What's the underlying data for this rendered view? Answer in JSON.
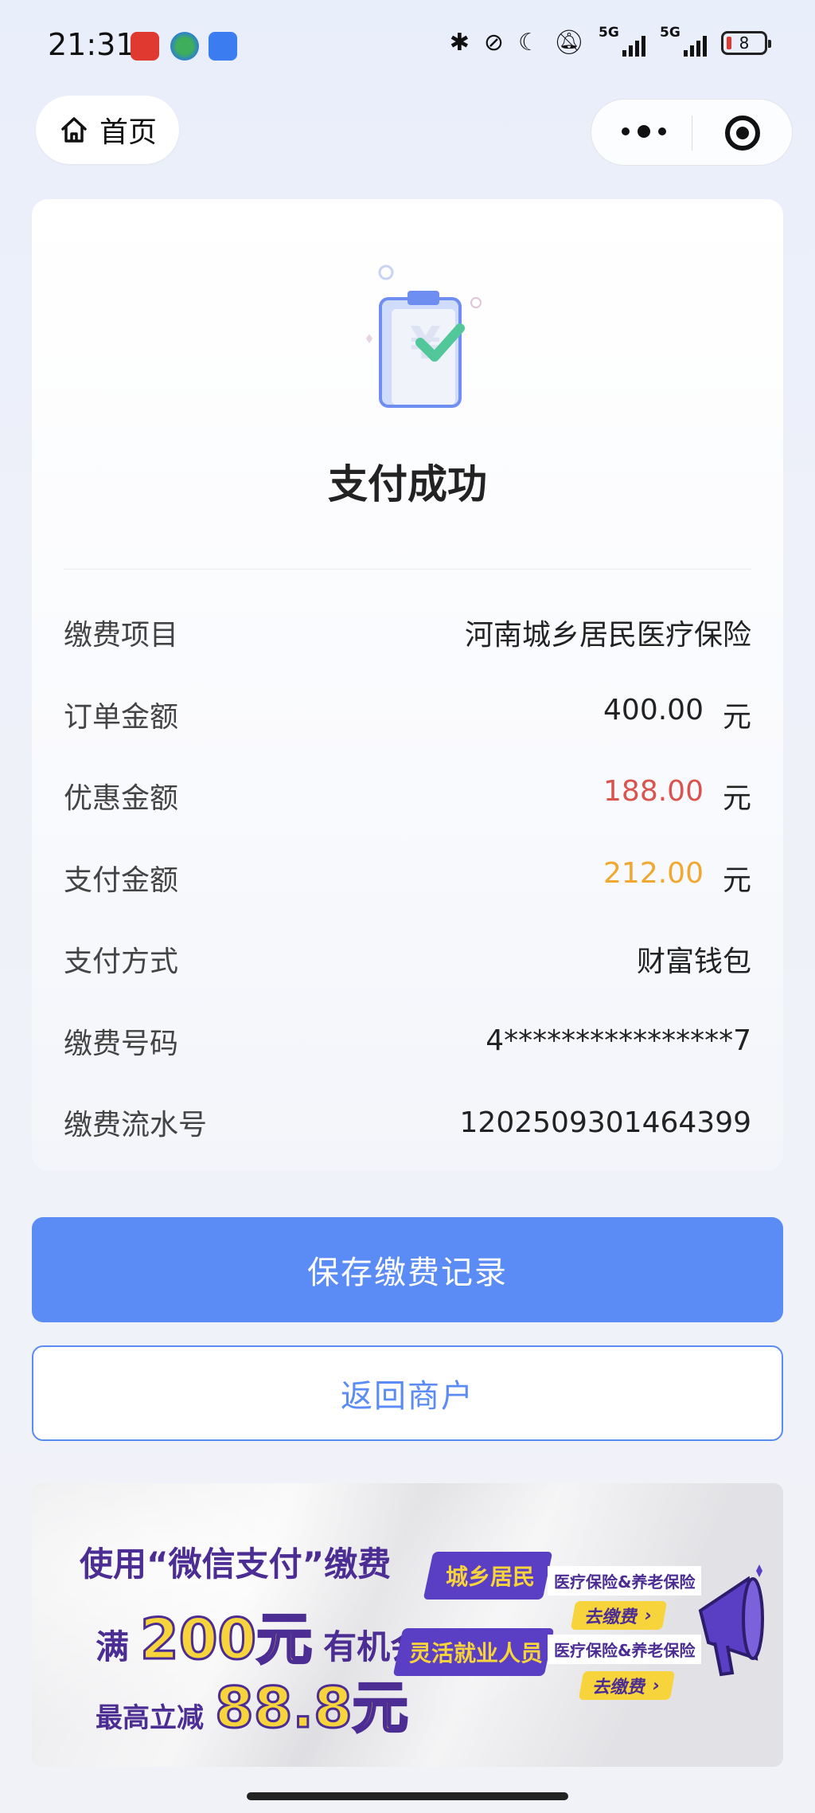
{
  "status_bar": {
    "time": "21:31",
    "network_1": "5G",
    "network_2": "5G",
    "battery": "8"
  },
  "nav": {
    "home_label": "首页"
  },
  "result": {
    "title": "支付成功"
  },
  "details": [
    {
      "key": "缴费项目",
      "value": "河南城乡居民医疗保险",
      "unit": "",
      "color": "#222222"
    },
    {
      "key": "订单金额",
      "value": "400.00",
      "unit": "元",
      "color": "#222222"
    },
    {
      "key": "优惠金额",
      "value": "188.00",
      "unit": "元",
      "color": "#d9534f"
    },
    {
      "key": "支付金额",
      "value": "212.00",
      "unit": "元",
      "color": "#f0a830"
    },
    {
      "key": "支付方式",
      "value": "财富钱包",
      "unit": "",
      "color": "#222222"
    },
    {
      "key": "缴费号码",
      "value": "4****************7",
      "unit": "",
      "color": "#222222"
    },
    {
      "key": "缴费流水号",
      "value": "1202509301464399",
      "unit": "",
      "color": "#222222"
    }
  ],
  "buttons": {
    "save": "保存缴费记录",
    "back": "返回商户"
  },
  "banner": {
    "line1": "使用“微信支付”缴费",
    "line2_prefix": "满",
    "line2_amount": "200元",
    "line2_suffix": "有机会",
    "line3_prefix": "最高立减",
    "line3_amount": "88.8元",
    "option1_title": "城乡居民",
    "option1_sub": "医疗保险&养老保险",
    "option1_go": "去缴费",
    "option2_title": "灵活就业人员",
    "option2_sub": "医疗保险&养老保险",
    "option2_go": "去缴费"
  },
  "colors": {
    "primary": "#5b8bf4",
    "discount": "#d9534f",
    "paid": "#f0a830",
    "banner_purple": "#4b2d93",
    "banner_yellow": "#f7d33c"
  }
}
